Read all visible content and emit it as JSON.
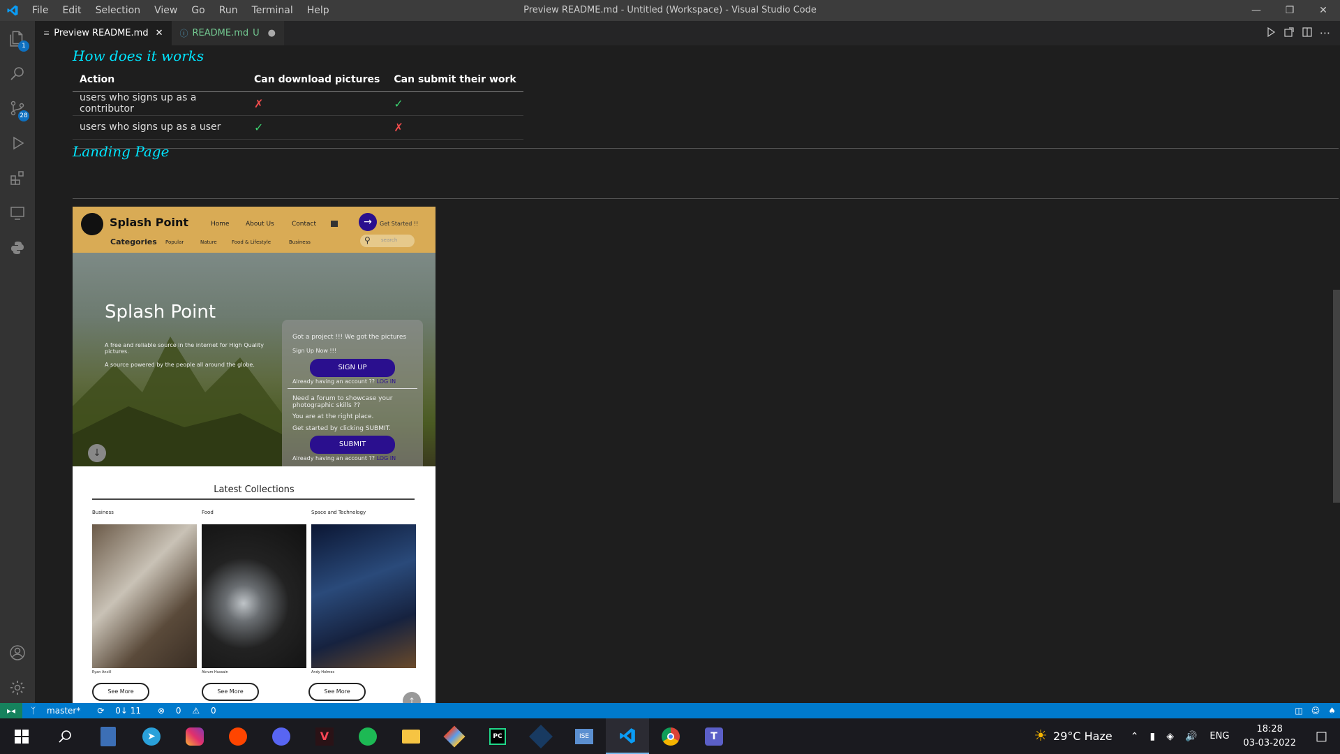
{
  "titlebar": {
    "menu": [
      "File",
      "Edit",
      "Selection",
      "View",
      "Go",
      "Run",
      "Terminal",
      "Help"
    ],
    "window_title": "Preview README.md - Untitled (Workspace) - Visual Studio Code"
  },
  "activity": {
    "explorer_badge": "1",
    "scm_badge": "28"
  },
  "tabs": [
    {
      "label": "Preview README.md",
      "active": true
    },
    {
      "label": "README.md",
      "status": "U",
      "active": false
    }
  ],
  "doc": {
    "section1": "How does it works",
    "table": {
      "headers": [
        "Action",
        "Can download pictures",
        "Can submit their work"
      ],
      "rows": [
        {
          "action": "users who signs up as a contributor",
          "download": "✗",
          "submit": "✓"
        },
        {
          "action": "users who signs up as a user",
          "download": "✓",
          "submit": "✗"
        }
      ]
    },
    "section2": "Landing Page"
  },
  "preview": {
    "brand": "Splash Point",
    "nav": [
      "Home",
      "About Us",
      "Contact"
    ],
    "cta": "Get Started !!",
    "categories_label": "Categories",
    "categories": [
      "Popular",
      "Nature",
      "Food & Lifestyle",
      "Business"
    ],
    "search_placeholder": "search",
    "hero_title": "Splash Point",
    "hero_sub1": "A free and reliable source in the internet for High Quality pictures.",
    "hero_sub2": "A source powered by the people all around the globe.",
    "card": {
      "line1": "Got a project !!! We got the pictures",
      "line2": "Sign Up Now !!!",
      "signup": "SIGN UP",
      "login_prompt1": "Already having an account ??",
      "login1": "LOG IN",
      "line3": "Need a forum to showcase your photographic skills ??",
      "line4": "You are at the right place.",
      "line5": "Get started by clicking SUBMIT.",
      "submit": "SUBMIT",
      "login_prompt2": "Already having an account ??",
      "login2": "LOG IN"
    },
    "collections_title": "Latest Collections",
    "collections": [
      {
        "cat": "Business",
        "author": "Ryan Ancill",
        "btn": "See More"
      },
      {
        "cat": "Food",
        "author": "Akrum Hussain",
        "btn": "See More"
      },
      {
        "cat": "Space and Technology",
        "author": "Andy Holmes",
        "btn": "See More"
      }
    ]
  },
  "statusbar": {
    "branch": "master*",
    "sync": "0↓ 11",
    "errors": "0",
    "warnings": "0"
  },
  "taskbar": {
    "weather": "29°C  Haze",
    "lang": "ENG",
    "time": "18:28",
    "date": "03-03-2022"
  },
  "colors": {
    "accent": "#007acc",
    "heading": "#00e5ff",
    "cross": "#f14c4c",
    "check": "#3bd16f"
  }
}
